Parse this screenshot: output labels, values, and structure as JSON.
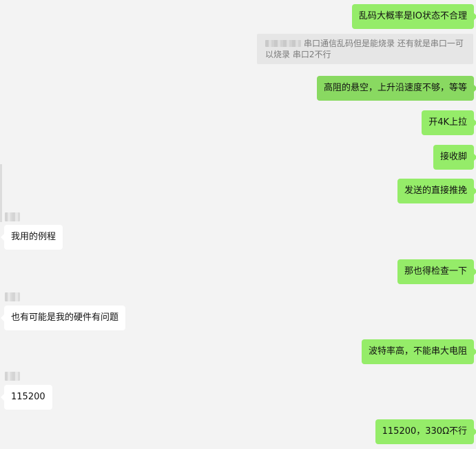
{
  "chat": {
    "messages": [
      {
        "id": "m1",
        "text": "乱码大概率是IO状态不合理"
      },
      {
        "id": "m2",
        "text": "串口通信乱码但是能烧录 还有就是串口一可以烧录 串口2不行"
      },
      {
        "id": "m3",
        "text": "高阻的悬空，上升沿速度不够，等等"
      },
      {
        "id": "m4",
        "text": "开4K上拉"
      },
      {
        "id": "m5",
        "text": "接收脚"
      },
      {
        "id": "m6",
        "text": "发送的直接推挽"
      },
      {
        "id": "m7",
        "text": "我用的例程"
      },
      {
        "id": "m8",
        "text": "那也得检查一下"
      },
      {
        "id": "m9",
        "text": "也有可能是我的硬件有问题"
      },
      {
        "id": "m10",
        "text": "波特率高，不能串大电阻"
      },
      {
        "id": "m11",
        "text": "115200"
      },
      {
        "id": "m12",
        "text": "115200，330Ω不行"
      }
    ]
  },
  "colors": {
    "background": "#f3f3f3",
    "outgoing_bubble": "#95ec69",
    "outgoing_bubble_selected": "#89d961",
    "incoming_bubble": "#ffffff",
    "quote_background": "#e6e6e6"
  }
}
